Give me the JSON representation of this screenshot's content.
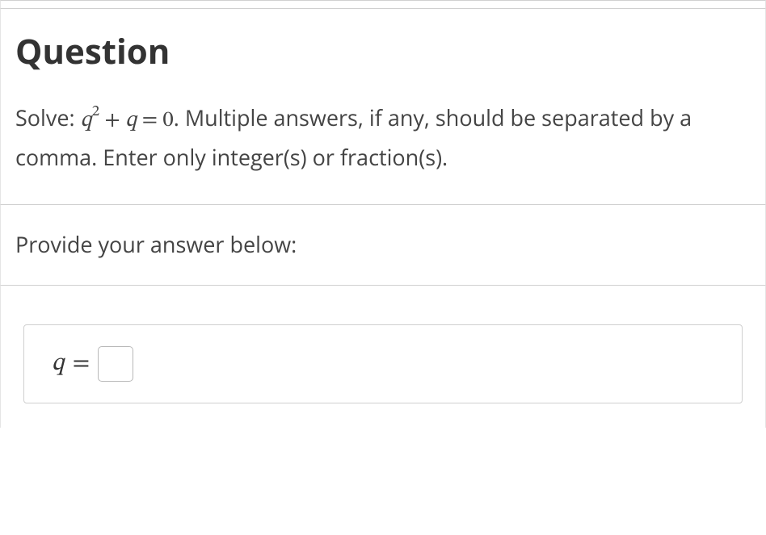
{
  "question": {
    "heading": "Question",
    "prefix": "Solve: ",
    "equation_var": "q",
    "equation_exp": "2",
    "equation_op": " + ",
    "equation_var2": "q",
    "equation_rhs": " = 0",
    "suffix": ". Multiple answers, if any, should be separated by a comma. Enter only integer(s) or fraction(s)."
  },
  "answer": {
    "prompt": "Provide your answer below:",
    "var_label": "q",
    "equals": "=",
    "value": ""
  }
}
